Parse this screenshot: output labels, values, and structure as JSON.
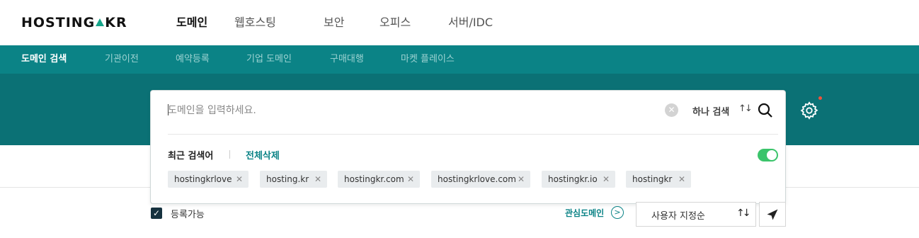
{
  "logo": {
    "left": "H",
    "text_before": "OSTING",
    "text_after": "KR"
  },
  "gnb": [
    {
      "label": "도메인",
      "active": true
    },
    {
      "label": "웹호스팅",
      "active": false
    },
    {
      "label": "보안",
      "active": false
    },
    {
      "label": "오피스",
      "active": false
    },
    {
      "label": "서버/IDC",
      "active": false
    }
  ],
  "subnav": [
    {
      "label": "도메인 검색",
      "active": true
    },
    {
      "label": "기관이전",
      "active": false
    },
    {
      "label": "예약등록",
      "active": false
    },
    {
      "label": "기업 도메인",
      "active": false
    },
    {
      "label": "구매대행",
      "active": false
    },
    {
      "label": "마켓 플레이스",
      "active": false
    }
  ],
  "search": {
    "placeholder": "도메인을 입력하세요.",
    "value": "",
    "mode_label": "하나 검색",
    "mode_icon": "swap-icon",
    "clear_icon": "clear-icon",
    "search_icon": "search-icon"
  },
  "recent": {
    "title": "최근 검색어",
    "delete_all": "전체삭제",
    "toggle_on": true,
    "chips": [
      "hostingkrlove",
      "hosting.kr",
      "hostingkr.com",
      "hostingkrlove.com",
      "hostingkr.io",
      "hostingkr"
    ]
  },
  "settings": {
    "icon": "gear-icon",
    "has_notification": true
  },
  "filters": {
    "available_label": "등록가능",
    "available_checked": true,
    "favorites_label": "관심도메인",
    "sort_label": "사용자 지정순",
    "sort_icon": "sort-icon",
    "send_icon": "send-icon"
  },
  "colors": {
    "accent": "#0b8386",
    "hero": "#0b7175",
    "toggle": "#3bc46b",
    "notify": "#f0523a"
  }
}
